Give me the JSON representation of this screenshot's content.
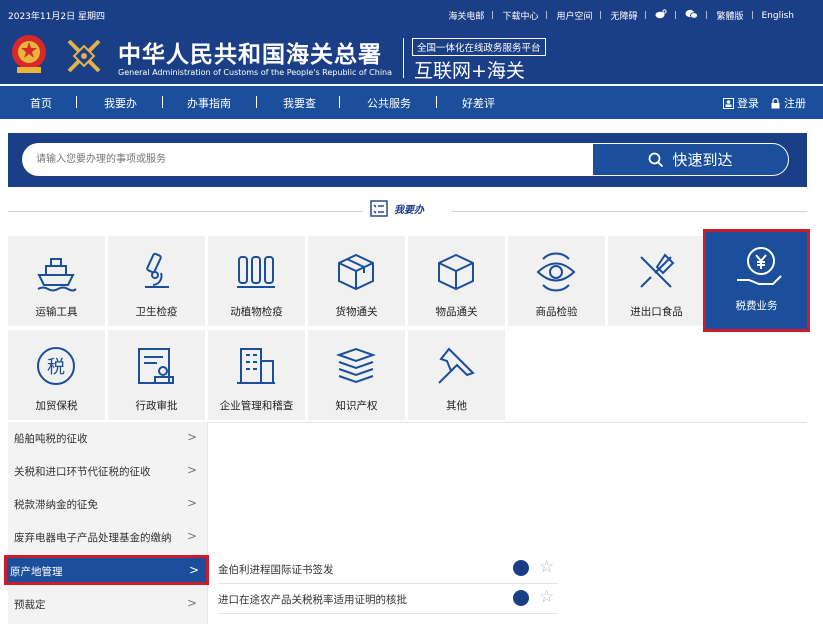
{
  "header": {
    "date": "2023年11月2日  星期四",
    "top_links": [
      "海关电邮",
      "下载中心",
      "用户空间",
      "无障碍",
      "微博",
      "微信",
      "繁體版",
      "English"
    ],
    "title_cn": "中华人民共和国海关总署",
    "title_en": "General Administration of Customs of the People's Republic of China",
    "platform_box": "全国一体化在线政务服务平台",
    "platform_name": "互联网+海关"
  },
  "nav": {
    "items": [
      "首页",
      "我要办",
      "办事指南",
      "我要查",
      "公共服务",
      "好差评"
    ],
    "login": "登录",
    "register": "注册"
  },
  "search": {
    "placeholder": "请输入您要办理的事项或服务",
    "button": "快速到达"
  },
  "section": {
    "title": "我要办"
  },
  "tiles": [
    {
      "label": "运输工具",
      "icon": "ship-icon"
    },
    {
      "label": "卫生检疫",
      "icon": "microscope-icon"
    },
    {
      "label": "动植物检疫",
      "icon": "fence-icon"
    },
    {
      "label": "货物通关",
      "icon": "box-icon"
    },
    {
      "label": "物品通关",
      "icon": "cube-icon"
    },
    {
      "label": "商品检验",
      "icon": "eye-check-icon"
    },
    {
      "label": "进出口食品",
      "icon": "fork-knife-icon"
    },
    {
      "label": "税费业务",
      "icon": "tax-hand-icon"
    },
    {
      "label": "加贸保税",
      "icon": "tax-circle-icon"
    },
    {
      "label": "行政审批",
      "icon": "approval-icon"
    },
    {
      "label": "企业管理和稽查",
      "icon": "building-icon"
    },
    {
      "label": "知识产权",
      "icon": "books-icon"
    },
    {
      "label": "其他",
      "icon": "pin-icon"
    }
  ],
  "list": [
    {
      "label": "船舶吨税的征收"
    },
    {
      "label": "关税和进口环节代征税的征收"
    },
    {
      "label": "税款滞纳金的征免"
    },
    {
      "label": "废弃电器电子产品处理基金的缴纳"
    },
    {
      "label": "原产地管理"
    },
    {
      "label": "预裁定"
    }
  ],
  "services": [
    {
      "label": "金伯利进程国际证书签发"
    },
    {
      "label": "进口在途农产品关税税率适用证明的核批"
    }
  ],
  "colors": {
    "header": "#1b3f86",
    "nav": "#1b4e9b",
    "highlight_border": "#cd1b2c",
    "tile_bg": "#f1f1f1"
  }
}
